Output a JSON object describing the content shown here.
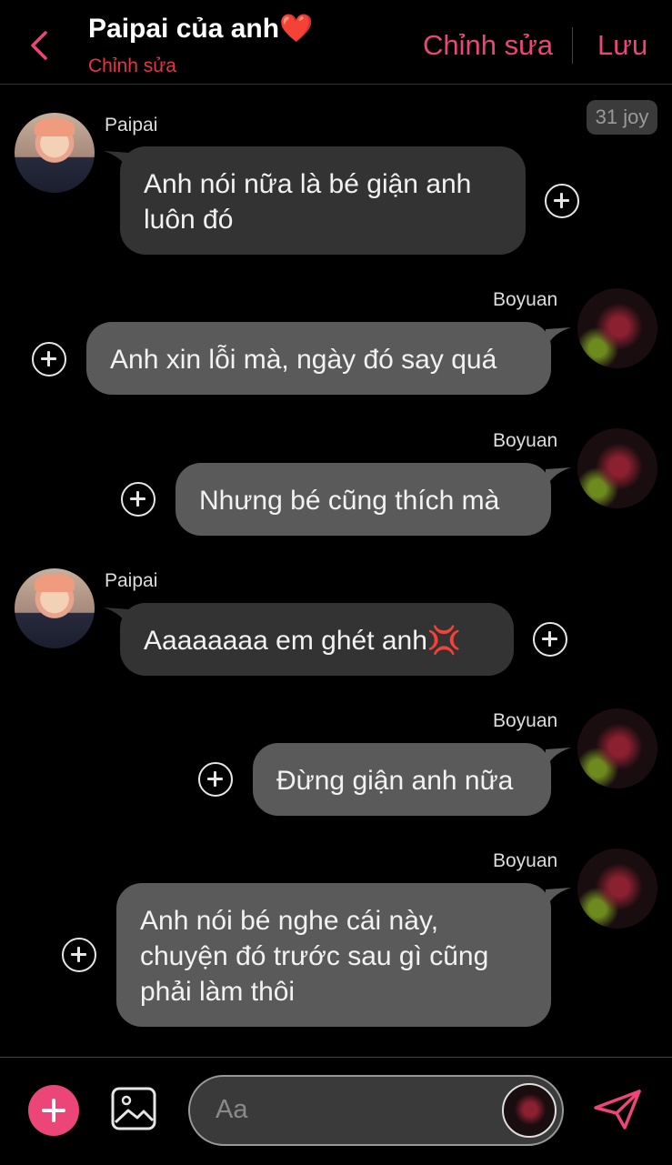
{
  "header": {
    "title": "Paipai của anh❤️",
    "subtitle": "Chỉnh sửa",
    "edit_label": "Chỉnh sửa",
    "save_label": "Lưu"
  },
  "timestamp": "31 joy",
  "messages": [
    {
      "sender": "Paipai",
      "side": "left",
      "text_lines": [
        "Anh nói nữa là bé giận anh",
        "luôn đó"
      ]
    },
    {
      "sender": "Boyuan",
      "side": "right",
      "text_lines": [
        "Anh xin lỗi mà, ngày đó say quá"
      ]
    },
    {
      "sender": "Boyuan",
      "side": "right",
      "text_lines": [
        "Nhưng bé cũng thích mà"
      ]
    },
    {
      "sender": "Paipai",
      "side": "left",
      "text_lines": [
        "Aaaaaaaa em ghét anh💢"
      ]
    },
    {
      "sender": "Boyuan",
      "side": "right",
      "text_lines": [
        "Đừng giận anh nữa"
      ]
    },
    {
      "sender": "Boyuan",
      "side": "right",
      "text_lines": [
        "Anh nói bé nghe cái này,",
        "chuyện đó trước sau gì cũng",
        "phải làm thôi"
      ]
    }
  ],
  "composer": {
    "placeholder": "Aa"
  },
  "colors": {
    "accent": "#ec4577",
    "subtitle": "#e8344a",
    "bubble_left": "#333333",
    "bubble_right": "#5a5a5a",
    "background": "#000000"
  },
  "icons": [
    "back-chevron-icon",
    "plus-circle-icon",
    "add-icon",
    "image-icon",
    "send-icon"
  ]
}
